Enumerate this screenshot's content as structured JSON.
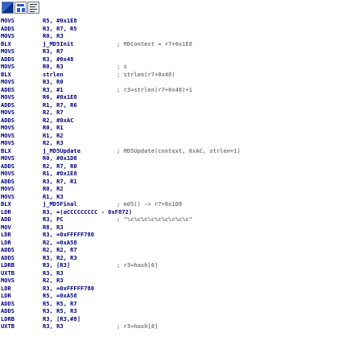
{
  "toolbar": [
    {
      "name": "disassembly-view-icon"
    },
    {
      "name": "graph-view-icon"
    },
    {
      "name": "text-view-icon"
    }
  ],
  "lines": [
    {
      "mnemonic": "MOVS",
      "operands": "R5, #0x1E8",
      "comment": ""
    },
    {
      "mnemonic": "ADDS",
      "operands": "R3, R7, R5",
      "comment": ""
    },
    {
      "mnemonic": "MOVS",
      "operands": "R0, R3",
      "comment": ""
    },
    {
      "mnemonic": "BLX",
      "operands": "j_MD5Init",
      "comment": "; MDContext = r7+0x1E8"
    },
    {
      "mnemonic": "MOVS",
      "operands": "R3, R7",
      "comment": ""
    },
    {
      "mnemonic": "ADDS",
      "operands": "R3, #0x48",
      "comment": ""
    },
    {
      "mnemonic": "MOVS",
      "operands": "R0, R3",
      "comment": "; s"
    },
    {
      "mnemonic": "BLX",
      "operands": "strlen",
      "comment": "; strlen(r7+0x48)"
    },
    {
      "mnemonic": "MOVS",
      "operands": "R3, R0",
      "comment": ""
    },
    {
      "mnemonic": "ADDS",
      "operands": "R3, #1",
      "comment": "; r3=strlen(r7+0x48)+1"
    },
    {
      "mnemonic": "MOVS",
      "operands": "R6, #0x1E8",
      "comment": ""
    },
    {
      "mnemonic": "ADDS",
      "operands": "R1, R7, R6",
      "comment": ""
    },
    {
      "mnemonic": "MOVS",
      "operands": "R2, R7",
      "comment": ""
    },
    {
      "mnemonic": "ADDS",
      "operands": "R2, #0xAC",
      "comment": ""
    },
    {
      "mnemonic": "MOVS",
      "operands": "R0, R1",
      "comment": ""
    },
    {
      "mnemonic": "MOVS",
      "operands": "R1, R2",
      "comment": ""
    },
    {
      "mnemonic": "MOVS",
      "operands": "R2, R3",
      "comment": ""
    },
    {
      "mnemonic": "BLX",
      "operands": "j_MD5Update",
      "comment": "; MD5Update(context, 0xAC, strlen+1)"
    },
    {
      "mnemonic": "MOVS",
      "operands": "R0, #0x1D8",
      "comment": ""
    },
    {
      "mnemonic": "ADDS",
      "operands": "R2, R7, R0",
      "comment": ""
    },
    {
      "mnemonic": "MOVS",
      "operands": "R1, #0x1E8",
      "comment": ""
    },
    {
      "mnemonic": "ADDS",
      "operands": "R3, R7, R1",
      "comment": ""
    },
    {
      "mnemonic": "MOVS",
      "operands": "R0, R2",
      "comment": ""
    },
    {
      "mnemonic": "MOVS",
      "operands": "R1, R3",
      "comment": ""
    },
    {
      "mnemonic": "BLX",
      "operands": "j_MD5Final",
      "comment": "; md5() -> r7+0x1D8"
    },
    {
      "mnemonic": "LDR",
      "operands": "R3, =(aCCCCCCCCC - 0xF872)",
      "comment": ""
    },
    {
      "mnemonic": "ADD",
      "operands": "R3, PC",
      "comment": "; \"%c%c%c%c%c%c%c%c%c\""
    },
    {
      "mnemonic": "MOV",
      "operands": "R8, R3",
      "comment": ""
    },
    {
      "mnemonic": "LDR",
      "operands": "R3, =0xFFFFF780",
      "comment": ""
    },
    {
      "mnemonic": "LDR",
      "operands": "R2, =0xA58",
      "comment": ""
    },
    {
      "mnemonic": "ADDS",
      "operands": "R2, R2, R7",
      "comment": ""
    },
    {
      "mnemonic": "ADDS",
      "operands": "R3, R2, R3",
      "comment": ""
    },
    {
      "mnemonic": "LDRB",
      "operands": "R3, [R3]",
      "comment": "; r3=hash[0]"
    },
    {
      "mnemonic": "UXTB",
      "operands": "R3, R3",
      "comment": ""
    },
    {
      "mnemonic": "MOVS",
      "operands": "R2, R3",
      "comment": ""
    },
    {
      "mnemonic": "LDR",
      "operands": "R3, =0xFFFFF780",
      "comment": ""
    },
    {
      "mnemonic": "LDR",
      "operands": "R5, =0xA58",
      "comment": ""
    },
    {
      "mnemonic": "ADDS",
      "operands": "R5, R5, R7",
      "comment": ""
    },
    {
      "mnemonic": "ADDS",
      "operands": "R3, R5, R3",
      "comment": ""
    },
    {
      "mnemonic": "LDRB",
      "operands": "R3, [R3,#8]",
      "comment": ""
    },
    {
      "mnemonic": "UXTB",
      "operands": "R3, R3",
      "comment": "; r3=hash[8]"
    }
  ]
}
